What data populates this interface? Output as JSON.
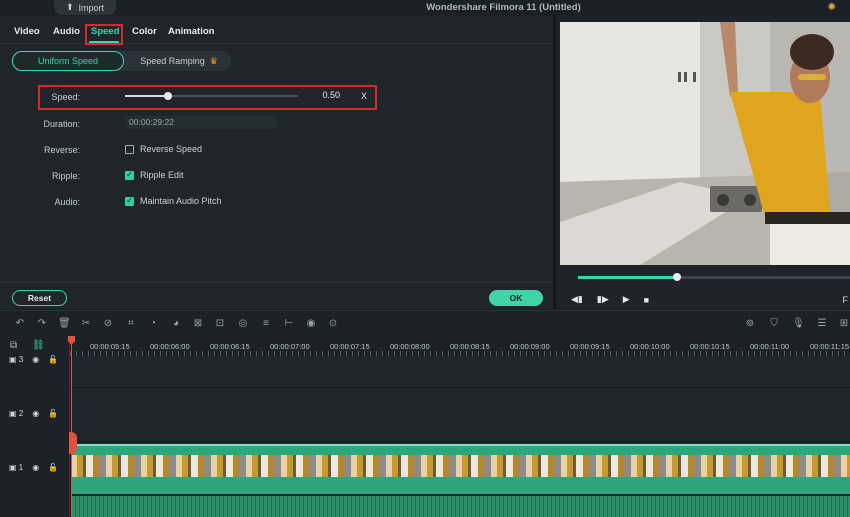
{
  "app": {
    "title": "Wondershare Filmora 11 (Untitled)",
    "import_label": "Import"
  },
  "tabs": [
    "Video",
    "Audio",
    "Speed",
    "Color",
    "Animation"
  ],
  "active_tab": "Speed",
  "subtabs": {
    "uniform": "Uniform Speed",
    "ramping": "Speed Ramping"
  },
  "speed": {
    "label": "Speed:",
    "value": "0.50",
    "multiplier": "X",
    "slider_fraction": 0.25,
    "duration_label": "Duration:",
    "duration_value": "00:00:29:22",
    "reverse_label": "Reverse:",
    "reverse_option": "Reverse Speed",
    "reverse_checked": false,
    "ripple_label": "Ripple:",
    "ripple_option": "Ripple Edit",
    "ripple_checked": true,
    "audio_label": "Audio:",
    "audio_option": "Maintain Audio Pitch",
    "audio_checked": true
  },
  "buttons": {
    "reset": "Reset",
    "ok": "OK"
  },
  "preview": {
    "progress_fraction": 0.36,
    "right_label": "F"
  },
  "timeline": {
    "ruler": [
      "00:00:05:15",
      "00:00:06:00",
      "00:00:06:15",
      "00:00:07:00",
      "00:00:07:15",
      "00:00:08:00",
      "00:00:08:15",
      "00:00:09:00",
      "00:00:09:15",
      "00:00:10:00",
      "00:00:10:15",
      "00:00:11:00",
      "00:00:11:15"
    ],
    "tracks": [
      "3",
      "2",
      "1"
    ]
  },
  "colors": {
    "accent": "#34d9b1",
    "highlight": "#d42a2a",
    "clip": "#2ea57b",
    "playhead": "#e2513f"
  }
}
